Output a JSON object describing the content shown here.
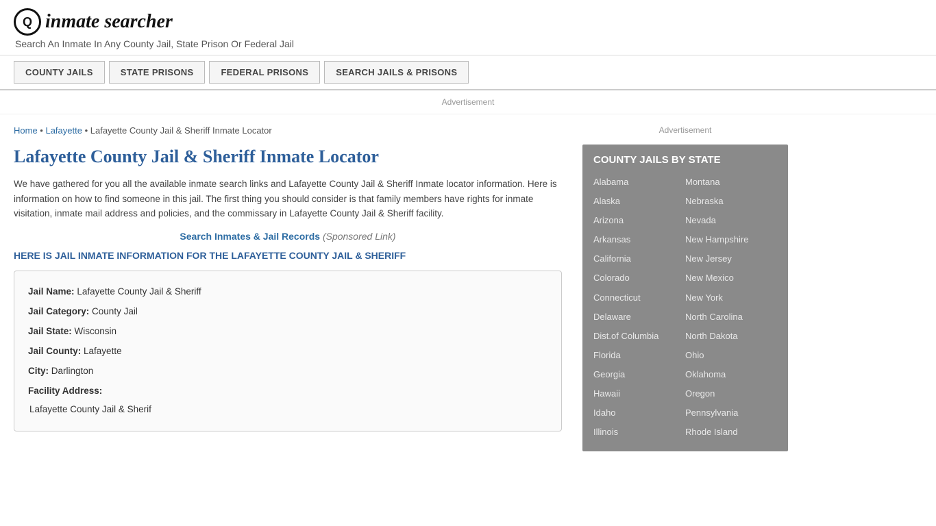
{
  "header": {
    "logo_icon": "Q",
    "logo_text": "inmate searcher",
    "tagline": "Search An Inmate In Any County Jail, State Prison Or Federal Jail"
  },
  "nav": {
    "items": [
      {
        "label": "COUNTY JAILS",
        "id": "county-jails"
      },
      {
        "label": "STATE PRISONS",
        "id": "state-prisons"
      },
      {
        "label": "FEDERAL PRISONS",
        "id": "federal-prisons"
      },
      {
        "label": "SEARCH JAILS & PRISONS",
        "id": "search-jails"
      }
    ]
  },
  "ad_label": "Advertisement",
  "breadcrumb": {
    "home": "Home",
    "parent": "Lafayette",
    "current": "Lafayette County Jail & Sheriff Inmate Locator"
  },
  "page_title": "Lafayette County Jail & Sheriff Inmate Locator",
  "description": "We have gathered for you all the available inmate search links and Lafayette County Jail & Sheriff Inmate locator information. Here is information on how to find someone in this jail. The first thing you should consider is that family members have rights for inmate visitation, inmate mail address and policies, and the commissary in Lafayette County Jail & Sheriff facility.",
  "sponsored_link_text": "Search Inmates & Jail Records",
  "sponsored_note": "(Sponsored Link)",
  "section_heading": "HERE IS JAIL INMATE INFORMATION FOR THE LAFAYETTE COUNTY JAIL & SHERIFF",
  "jail_info": {
    "name_label": "Jail Name:",
    "name_value": "Lafayette County Jail & Sheriff",
    "category_label": "Jail Category:",
    "category_value": "County Jail",
    "state_label": "Jail State:",
    "state_value": "Wisconsin",
    "county_label": "Jail County:",
    "county_value": "Lafayette",
    "city_label": "City:",
    "city_value": "Darlington",
    "address_label": "Facility Address:",
    "address_value": "Lafayette County Jail & Sherif"
  },
  "sidebar": {
    "ad_label": "Advertisement",
    "box_title": "COUNTY JAILS BY STATE",
    "states_left": [
      "Alabama",
      "Alaska",
      "Arizona",
      "Arkansas",
      "California",
      "Colorado",
      "Connecticut",
      "Delaware",
      "Dist.of Columbia",
      "Florida",
      "Georgia",
      "Hawaii",
      "Idaho",
      "Illinois"
    ],
    "states_right": [
      "Montana",
      "Nebraska",
      "Nevada",
      "New Hampshire",
      "New Jersey",
      "New Mexico",
      "New York",
      "North Carolina",
      "North Dakota",
      "Ohio",
      "Oklahoma",
      "Oregon",
      "Pennsylvania",
      "Rhode Island"
    ]
  }
}
